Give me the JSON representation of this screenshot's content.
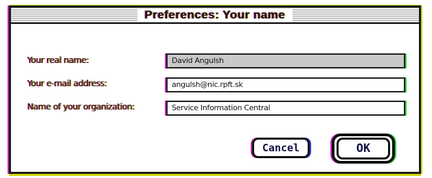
{
  "window": {
    "title": "Preferences: Your name"
  },
  "fields": [
    {
      "label": "Your real name:",
      "value": "David Angulsh"
    },
    {
      "label": "Your e-mail address:",
      "value": "angulsh@nic.rpft.sk"
    },
    {
      "label": "Name of your organization:",
      "value": "Service Information Central"
    }
  ],
  "buttons": {
    "cancel": "Cancel",
    "ok": "OK"
  }
}
